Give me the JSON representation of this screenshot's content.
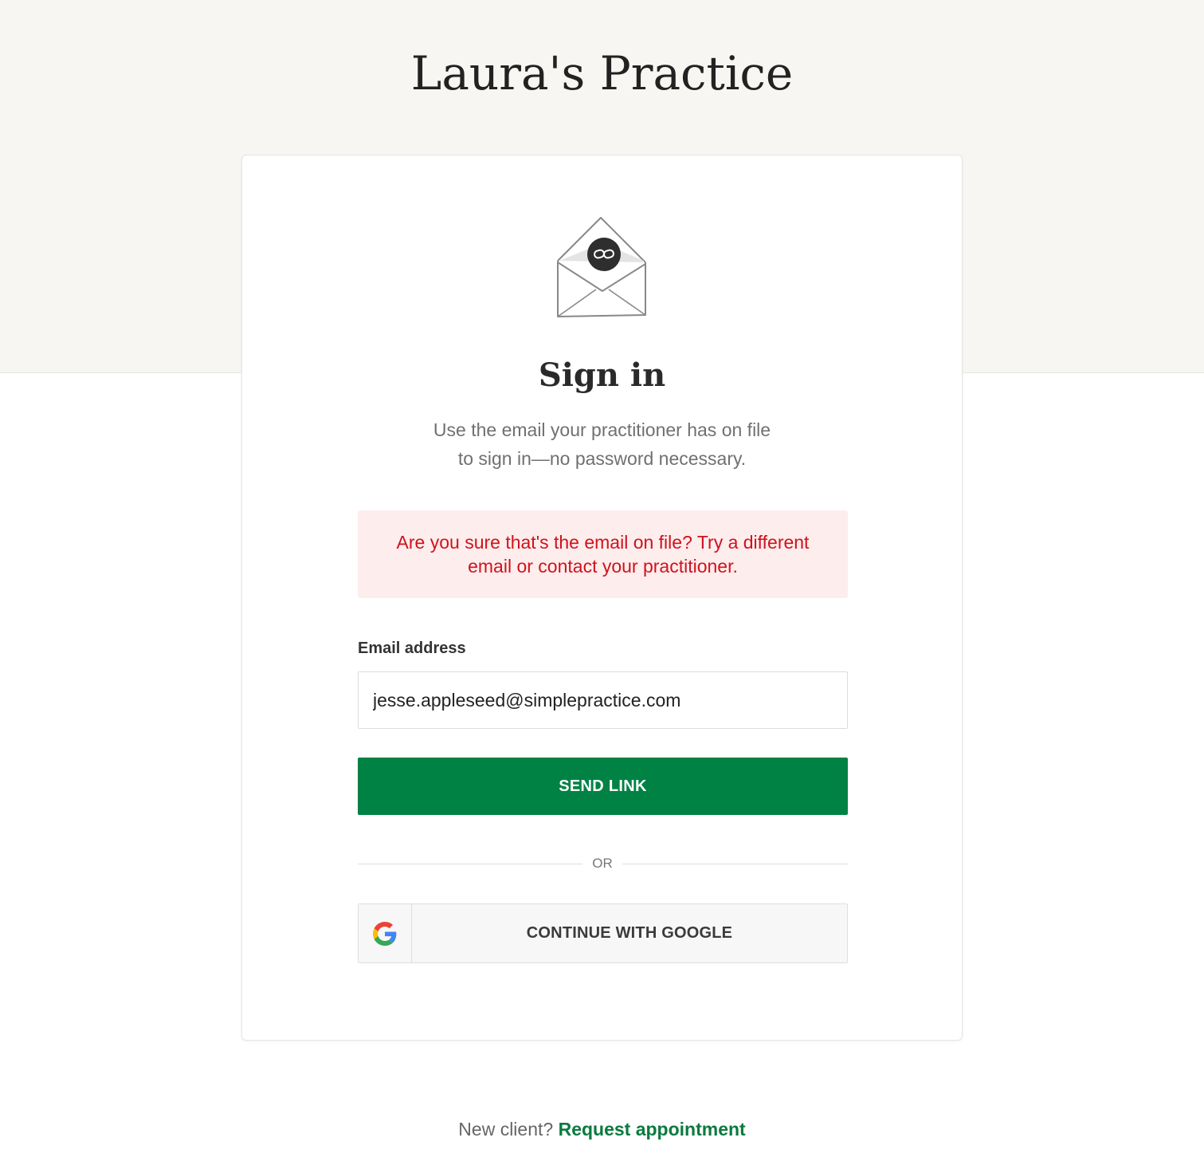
{
  "header": {
    "practice_name": "Laura's Practice"
  },
  "card": {
    "title": "Sign in",
    "subtitle_line1": "Use the email your practitioner has on file",
    "subtitle_line2": "to sign in—no password necessary.",
    "error_message": "Are you sure that's the email on file? Try a different email or contact your practitioner.",
    "email_label": "Email address",
    "email_value": "jesse.appleseed@simplepractice.com",
    "send_button_label": "SEND LINK",
    "divider_text": "OR",
    "google_button_label": "CONTINUE WITH GOOGLE"
  },
  "footer": {
    "prompt": "New client?",
    "link_text": "Request appointment"
  },
  "colors": {
    "top_band": "#f7f6f2",
    "primary_green": "#008245",
    "error_text": "#d0121c",
    "error_bg": "#fdeded"
  },
  "icons": {
    "envelope": "envelope-link-icon",
    "google": "google-icon"
  }
}
